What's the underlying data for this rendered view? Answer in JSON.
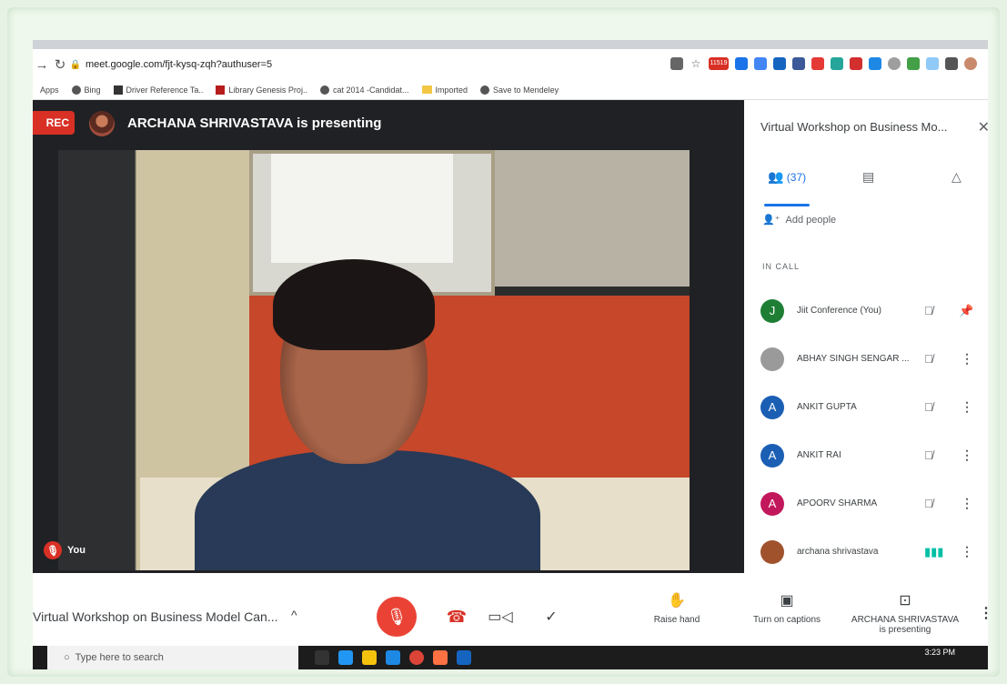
{
  "browser": {
    "url": "meet.google.com/fjt-kysq-zqh?authuser=5",
    "bookmarks": [
      "Apps",
      "Bing",
      "Driver Reference Ta..",
      "Library Genesis Proj..",
      "cat 2014 -Candidat...",
      "Imported",
      "Save to Mendeley"
    ],
    "ext_badge": "11519"
  },
  "meet": {
    "rec_label": "REC",
    "presenter_banner": "ARCHANA SHRIVASTAVA is presenting",
    "self_label": "You"
  },
  "panel": {
    "title": "Virtual Workshop on Business Mo...",
    "people_count": "(37)",
    "add_people": "Add people",
    "in_call": "IN CALL",
    "participants": [
      {
        "initial": "J",
        "name": "Jiit Conference (You)",
        "color": "#1e7e34"
      },
      {
        "initial": "",
        "name": "ABHAY SINGH SENGAR ...",
        "color": "#9a9a9a"
      },
      {
        "initial": "A",
        "name": "ANKIT GUPTA",
        "color": "#1a5fb4"
      },
      {
        "initial": "A",
        "name": "ANKIT RAI",
        "color": "#1a5fb4"
      },
      {
        "initial": "A",
        "name": "APOORV SHARMA",
        "color": "#c2185b"
      },
      {
        "initial": "",
        "name": "archana shrivastava",
        "color": "#a0522d"
      }
    ]
  },
  "bottom": {
    "meeting_name": "Virtual Workshop on Business Model Can...",
    "raise_hand": "Raise hand",
    "captions": "Turn on captions",
    "presenting_line1": "ARCHANA SHRIVASTAVA",
    "presenting_line2": "is presenting"
  },
  "taskbar": {
    "search": "Type here to search",
    "time": "3:23 PM"
  }
}
